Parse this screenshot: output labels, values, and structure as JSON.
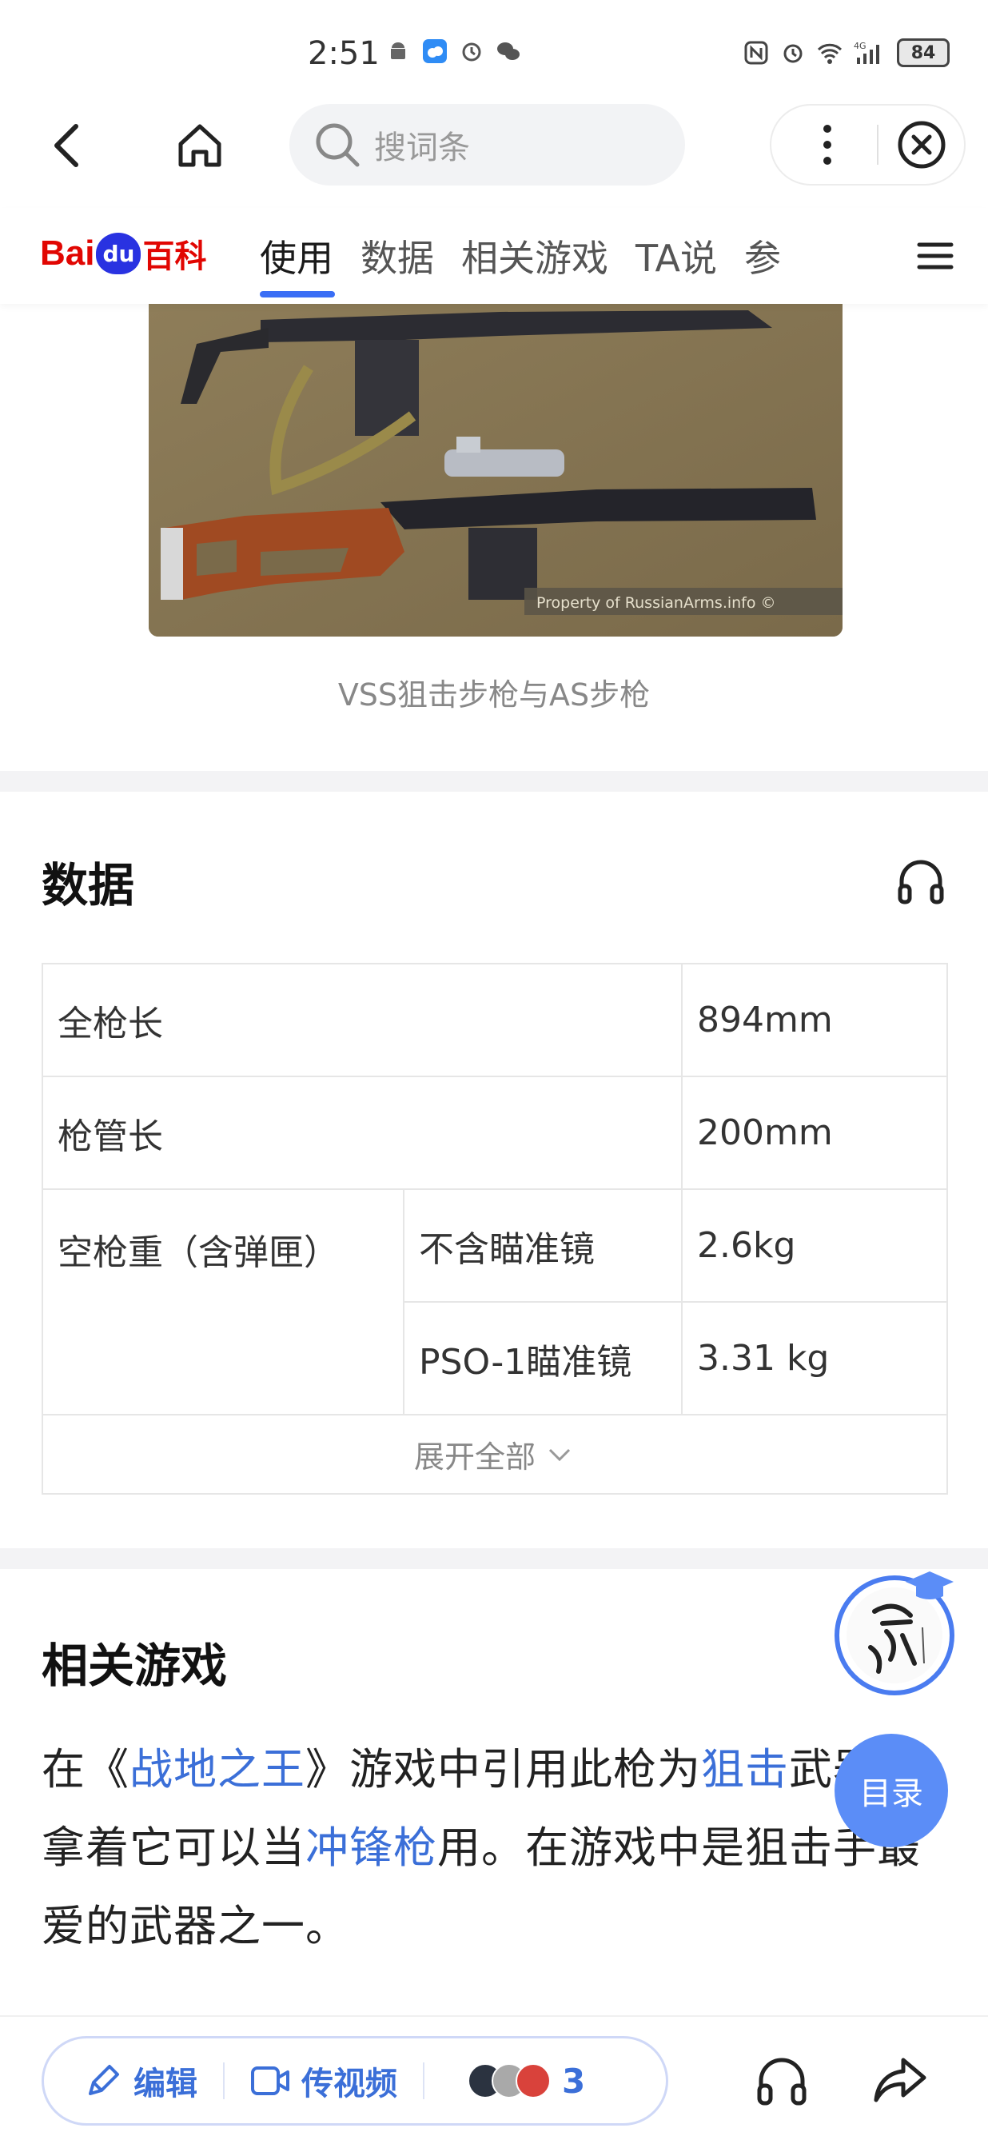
{
  "status_bar": {
    "time": "2:51",
    "battery": "84",
    "network": "4G"
  },
  "top_nav": {
    "search_placeholder": "搜词条"
  },
  "brand": {
    "bai": "Bai",
    "du": "du",
    "baike": "百科"
  },
  "tabs": [
    {
      "label": "使用",
      "active": true
    },
    {
      "label": "数据",
      "active": false
    },
    {
      "label": "相关游戏",
      "active": false
    },
    {
      "label": "TA说",
      "active": false
    },
    {
      "label": "参",
      "active": false
    }
  ],
  "photo": {
    "watermark": "Property of RussianArms.info ©",
    "caption": "VSS狙击步枪与AS步枪"
  },
  "data_section": {
    "title": "数据",
    "rows": {
      "total_length_label": "全枪长",
      "total_length_value": "894mm",
      "barrel_length_label": "枪管长",
      "barrel_length_value": "200mm",
      "empty_weight_label": "空枪重（含弹匣）",
      "no_scope_label": "不含瞄准镜",
      "no_scope_value": "2.6kg",
      "pso_label": "PSO-1瞄准镜",
      "pso_value": "3.31 kg"
    },
    "expand_label": "展开全部"
  },
  "games_section": {
    "title": "相关游戏",
    "p1": "在《",
    "link1": "战地之王",
    "p2": "》游戏中引用此枪为",
    "link2": "狙击",
    "p3": "武器，拿着它可以当",
    "link3": "冲锋枪",
    "p4": "用。在游戏中是狙击手最爱的武器之一。"
  },
  "floating": {
    "toc_label": "目录"
  },
  "bottom_bar": {
    "edit_label": "编辑",
    "video_label": "传视频",
    "contributors_count": "3"
  },
  "colors": {
    "accent": "#3b6fd8",
    "tab_indicator": "#3a6ef5",
    "brand_red": "#e10602",
    "brand_blue": "#2932e1"
  }
}
